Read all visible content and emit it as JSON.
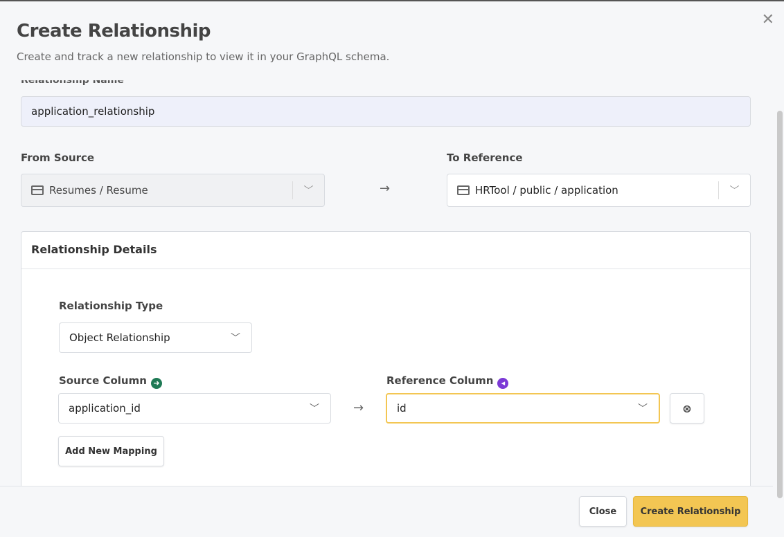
{
  "modal": {
    "title": "Create Relationship",
    "subtitle": "Create and track a new relationship to view it in your GraphQL schema.",
    "close_icon": "close-icon"
  },
  "form": {
    "name_label": "Relationship Name",
    "name_value": "application_relationship",
    "from_label": "From Source",
    "from_value": "Resumes / Resume",
    "to_label": "To Reference",
    "to_value": "HRTool / public / application"
  },
  "details": {
    "title": "Relationship Details",
    "type_label": "Relationship Type",
    "type_value": "Object Relationship",
    "source_label": "Source Column",
    "source_value": "application_id",
    "ref_label": "Reference Column",
    "ref_value": "id",
    "add_mapping": "Add New Mapping"
  },
  "footer": {
    "close": "Close",
    "create": "Create Relationship"
  },
  "colors": {
    "accent": "#f3c653",
    "source_dot": "#1f7a55",
    "ref_dot": "#7c3ad6",
    "focus_border": "#f3c653"
  }
}
